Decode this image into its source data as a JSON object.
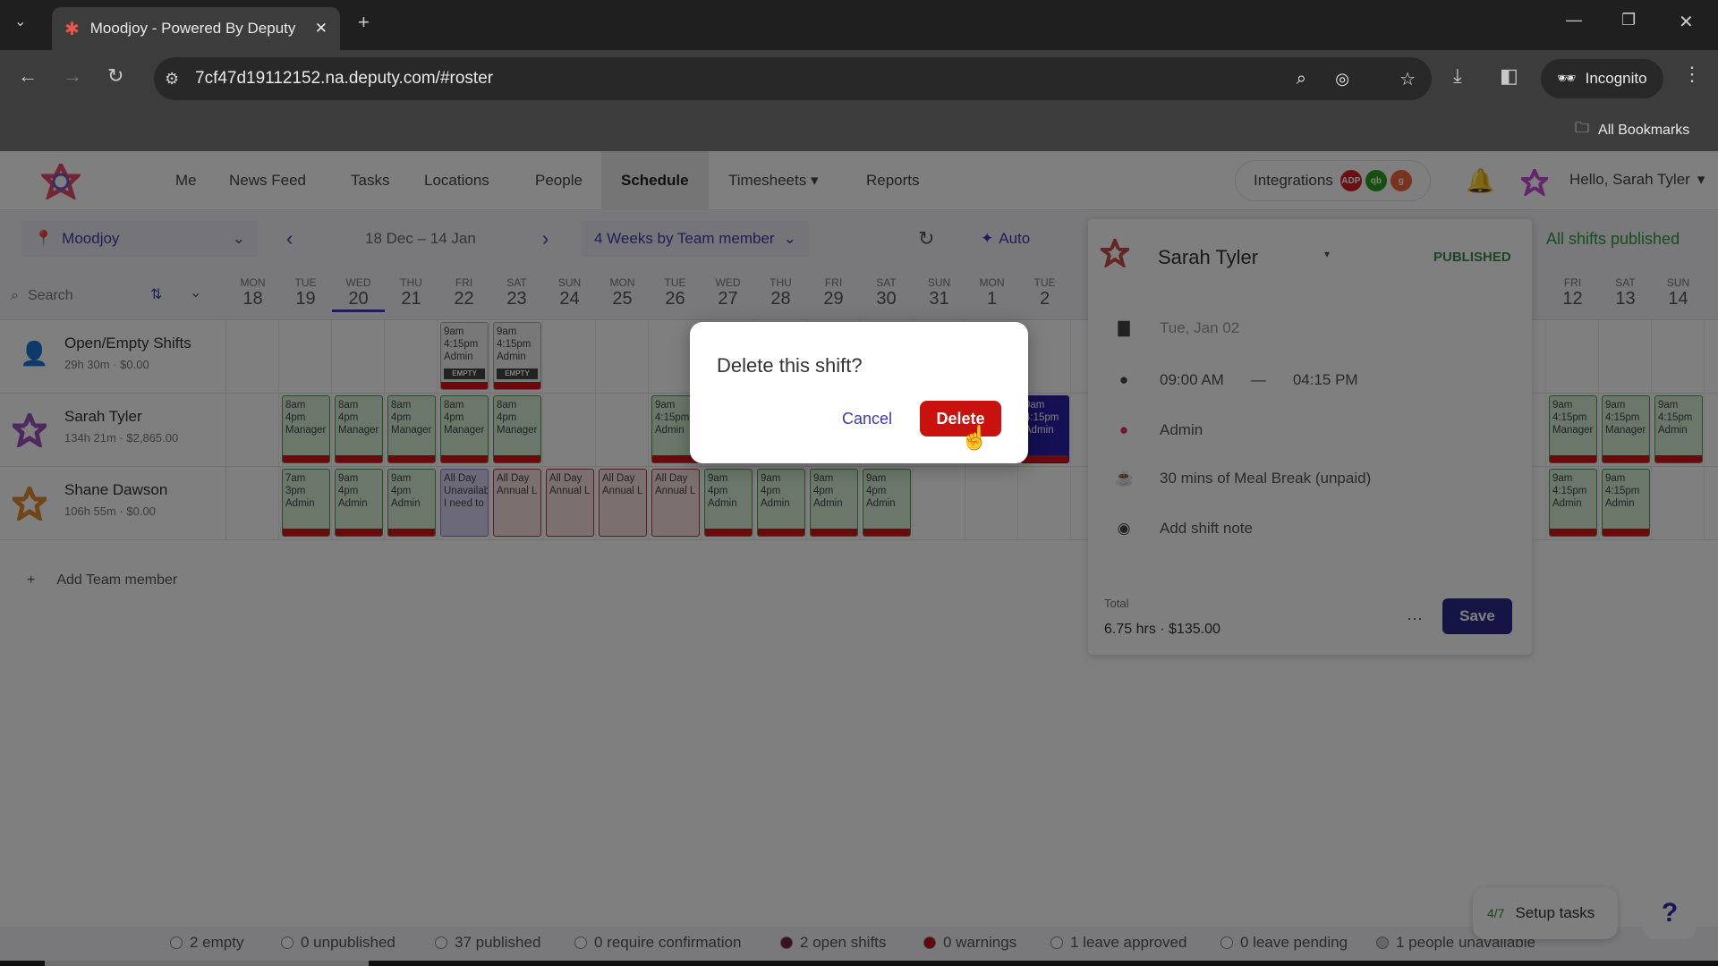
{
  "browser": {
    "tab_title": "Moodjoy - Powered By Deputy",
    "url": "7cf47d19112152.na.deputy.com/#roster",
    "incognito_label": "Incognito",
    "bookmarks_label": "All Bookmarks"
  },
  "nav": {
    "items": [
      "Me",
      "News Feed",
      "Tasks",
      "Locations",
      "People",
      "Schedule",
      "Timesheets ▾",
      "Reports"
    ],
    "active": "Schedule",
    "integrations_label": "Integrations",
    "integration_badges": [
      {
        "label": "ADP",
        "color": "#d0202b"
      },
      {
        "label": "qb",
        "color": "#2ca01c"
      },
      {
        "label": "g",
        "color": "#f0643c"
      }
    ],
    "greeting": "Hello, Sarah Tyler"
  },
  "toolbar": {
    "location": "Moodjoy",
    "date_range": "18 Dec – 14 Jan",
    "view": "4 Weeks by Team member",
    "auto_label": "Auto",
    "search_placeholder": "Search",
    "publish_status": "All shifts published"
  },
  "days": [
    {
      "dow": "MON",
      "date": "18"
    },
    {
      "dow": "TUE",
      "date": "19"
    },
    {
      "dow": "WED",
      "date": "20",
      "today": true
    },
    {
      "dow": "THU",
      "date": "21"
    },
    {
      "dow": "FRI",
      "date": "22"
    },
    {
      "dow": "SAT",
      "date": "23"
    },
    {
      "dow": "SUN",
      "date": "24"
    },
    {
      "dow": "MON",
      "date": "25"
    },
    {
      "dow": "TUE",
      "date": "26"
    },
    {
      "dow": "WED",
      "date": "27"
    },
    {
      "dow": "THU",
      "date": "28"
    },
    {
      "dow": "FRI",
      "date": "29"
    },
    {
      "dow": "SAT",
      "date": "30"
    },
    {
      "dow": "SUN",
      "date": "31"
    },
    {
      "dow": "MON",
      "date": "1"
    },
    {
      "dow": "TUE",
      "date": "2"
    },
    {
      "dow": "FRI",
      "date": "12"
    },
    {
      "dow": "SAT",
      "date": "13"
    },
    {
      "dow": "SUN",
      "date": "14"
    }
  ],
  "rows": [
    {
      "name": "Open/Empty Shifts",
      "summary": "29h 30m · $0.00",
      "type": "open",
      "shifts": [
        {
          "date": "22",
          "lines": [
            "9am",
            "4:15pm",
            "Admin"
          ],
          "kind": "open",
          "tag": "EMPTY"
        },
        {
          "date": "23",
          "lines": [
            "9am",
            "4:15pm",
            "Admin"
          ],
          "kind": "open",
          "tag": "EMPTY"
        }
      ]
    },
    {
      "name": "Sarah Tyler",
      "summary": "134h 21m · $2,865.00",
      "type": "person",
      "shifts": [
        {
          "date": "19",
          "lines": [
            "8am",
            "4pm",
            "Manager"
          ],
          "kind": "normal"
        },
        {
          "date": "20",
          "lines": [
            "8am",
            "4pm",
            "Manager"
          ],
          "kind": "normal"
        },
        {
          "date": "21",
          "lines": [
            "8am",
            "4pm",
            "Manager"
          ],
          "kind": "normal"
        },
        {
          "date": "22",
          "lines": [
            "8am",
            "4pm",
            "Manager"
          ],
          "kind": "normal"
        },
        {
          "date": "23",
          "lines": [
            "8am",
            "4pm",
            "Manager"
          ],
          "kind": "normal"
        },
        {
          "date": "26",
          "lines": [
            "9am",
            "4:15pm",
            "Admin"
          ],
          "kind": "normal"
        },
        {
          "date": "2",
          "lines": [
            "9am",
            "4:15pm",
            "Admin"
          ],
          "kind": "sel"
        },
        {
          "date": "12",
          "lines": [
            "9am",
            "4:15pm",
            "Manager"
          ],
          "kind": "normal"
        },
        {
          "date": "13",
          "lines": [
            "9am",
            "4:15pm",
            "Manager"
          ],
          "kind": "normal"
        },
        {
          "date": "14",
          "lines": [
            "9am",
            "4:15pm",
            "Admin"
          ],
          "kind": "normal"
        }
      ]
    },
    {
      "name": "Shane Dawson",
      "summary": "106h 55m · $0.00",
      "type": "person",
      "shifts": [
        {
          "date": "19",
          "lines": [
            "7am",
            "3pm",
            "Admin"
          ],
          "kind": "normal"
        },
        {
          "date": "20",
          "lines": [
            "9am",
            "4pm",
            "Admin"
          ],
          "kind": "normal"
        },
        {
          "date": "21",
          "lines": [
            "9am",
            "4pm",
            "Admin"
          ],
          "kind": "normal"
        },
        {
          "date": "22",
          "lines": [
            "All Day",
            "Unavailable",
            "I need to"
          ],
          "kind": "unavail"
        },
        {
          "date": "23",
          "lines": [
            "All Day",
            "Annual L"
          ],
          "kind": "leave"
        },
        {
          "date": "24",
          "lines": [
            "All Day",
            "Annual L"
          ],
          "kind": "leave"
        },
        {
          "date": "25",
          "lines": [
            "All Day",
            "Annual L"
          ],
          "kind": "leave"
        },
        {
          "date": "26",
          "lines": [
            "All Day",
            "Annual L"
          ],
          "kind": "leave"
        },
        {
          "date": "27",
          "lines": [
            "9am",
            "4pm",
            "Admin"
          ],
          "kind": "normal"
        },
        {
          "date": "28",
          "lines": [
            "9am",
            "4pm",
            "Admin"
          ],
          "kind": "normal"
        },
        {
          "date": "29",
          "lines": [
            "9am",
            "4pm",
            "Admin"
          ],
          "kind": "normal"
        },
        {
          "date": "30",
          "lines": [
            "9am",
            "4pm",
            "Admin"
          ],
          "kind": "normal"
        },
        {
          "date": "12",
          "lines": [
            "9am",
            "4:15pm",
            "Admin"
          ],
          "kind": "normal"
        },
        {
          "date": "13",
          "lines": [
            "9am",
            "4:15pm",
            "Admin"
          ],
          "kind": "normal"
        }
      ]
    }
  ],
  "add_member_label": "Add Team member",
  "status_bar": [
    {
      "label": "2 empty",
      "color": "#ffffff"
    },
    {
      "label": "0 unpublished",
      "color": "#ffffff"
    },
    {
      "label": "37 published",
      "color": "#ffffff"
    },
    {
      "label": "0 require confirmation",
      "color": "#ffffff"
    },
    {
      "label": "2 open shifts",
      "color": "#7a2040"
    },
    {
      "label": "0 warnings",
      "color": "#c0101a"
    },
    {
      "label": "1 leave approved",
      "color": "#ffffff"
    },
    {
      "label": "0 leave pending",
      "color": "#ffffff"
    },
    {
      "label": "1 people unavailable",
      "color": "#cccccc"
    }
  ],
  "setup": {
    "progress": "4/7",
    "label": "Setup tasks"
  },
  "help_label": "?",
  "panel": {
    "employee": "Sarah Tyler",
    "status": "PUBLISHED",
    "date": "Tue, Jan 02",
    "start": "09:00 AM",
    "dash": "—",
    "end": "04:15 PM",
    "area": "Admin",
    "break": "30 mins of Meal Break (unpaid)",
    "note_placeholder": "Add shift note",
    "total_label": "Total",
    "total_value": "6.75 hrs · $135.00",
    "more_label": "···",
    "save_label": "Save"
  },
  "modal": {
    "title": "Delete this shift?",
    "cancel_label": "Cancel",
    "delete_label": "Delete"
  }
}
